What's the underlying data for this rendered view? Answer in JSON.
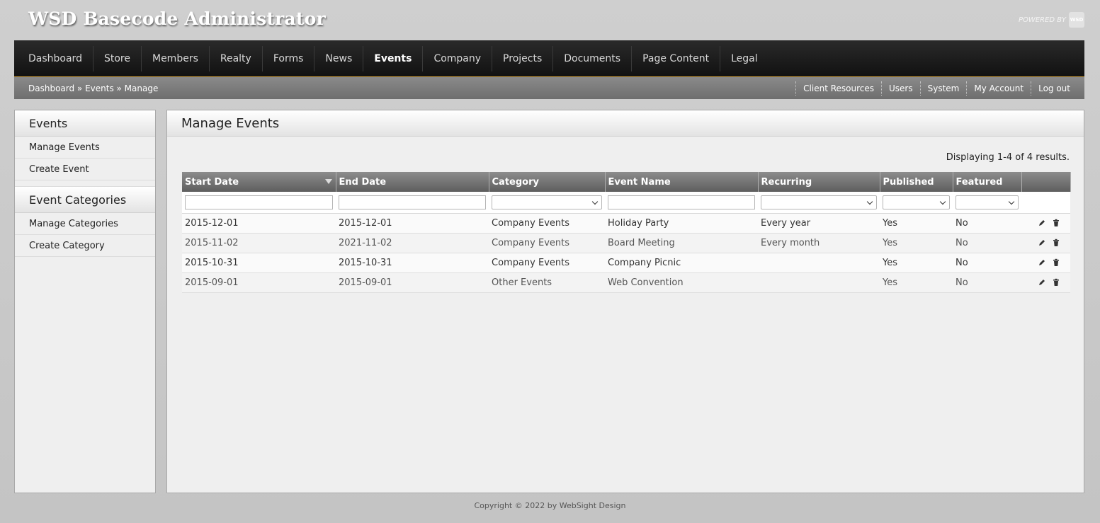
{
  "header": {
    "title": "WSD Basecode Administrator",
    "powered_by": "POWERED BY",
    "logo_text": "WSD"
  },
  "mainnav": {
    "items": [
      "Dashboard",
      "Store",
      "Members",
      "Realty",
      "Forms",
      "News",
      "Events",
      "Company",
      "Projects",
      "Documents",
      "Page Content",
      "Legal"
    ],
    "active": "Events"
  },
  "subbar": {
    "breadcrumb": "Dashboard » Events » Manage",
    "links": [
      "Client Resources",
      "Users",
      "System",
      "My Account",
      "Log out"
    ]
  },
  "sidebar": {
    "sections": [
      {
        "title": "Events",
        "items": [
          "Manage Events",
          "Create Event"
        ]
      },
      {
        "title": "Event Categories",
        "items": [
          "Manage Categories",
          "Create Category"
        ]
      }
    ]
  },
  "main": {
    "title": "Manage Events",
    "summary": "Displaying 1-4 of 4 results.",
    "columns": [
      "Start Date",
      "End Date",
      "Category",
      "Event Name",
      "Recurring",
      "Published",
      "Featured",
      ""
    ],
    "rows": [
      {
        "start": "2015-12-01",
        "end": "2015-12-01",
        "category": "Company Events",
        "name": "Holiday Party",
        "recurring": "Every year",
        "published": "Yes",
        "featured": "No"
      },
      {
        "start": "2015-11-02",
        "end": "2021-11-02",
        "category": "Company Events",
        "name": "Board Meeting",
        "recurring": "Every month",
        "published": "Yes",
        "featured": "No"
      },
      {
        "start": "2015-10-31",
        "end": "2015-10-31",
        "category": "Company Events",
        "name": "Company Picnic",
        "recurring": "",
        "published": "Yes",
        "featured": "No"
      },
      {
        "start": "2015-09-01",
        "end": "2015-09-01",
        "category": "Other Events",
        "name": "Web Convention",
        "recurring": "",
        "published": "Yes",
        "featured": "No"
      }
    ]
  },
  "footer": {
    "copyright": "Copyright © 2022 by WebSight Design"
  },
  "colors": {
    "nav_bg": "#1b1b1b",
    "nav_accent": "#d5a540",
    "subbar_bg": "#7c7c7c",
    "table_header": "#707070"
  }
}
